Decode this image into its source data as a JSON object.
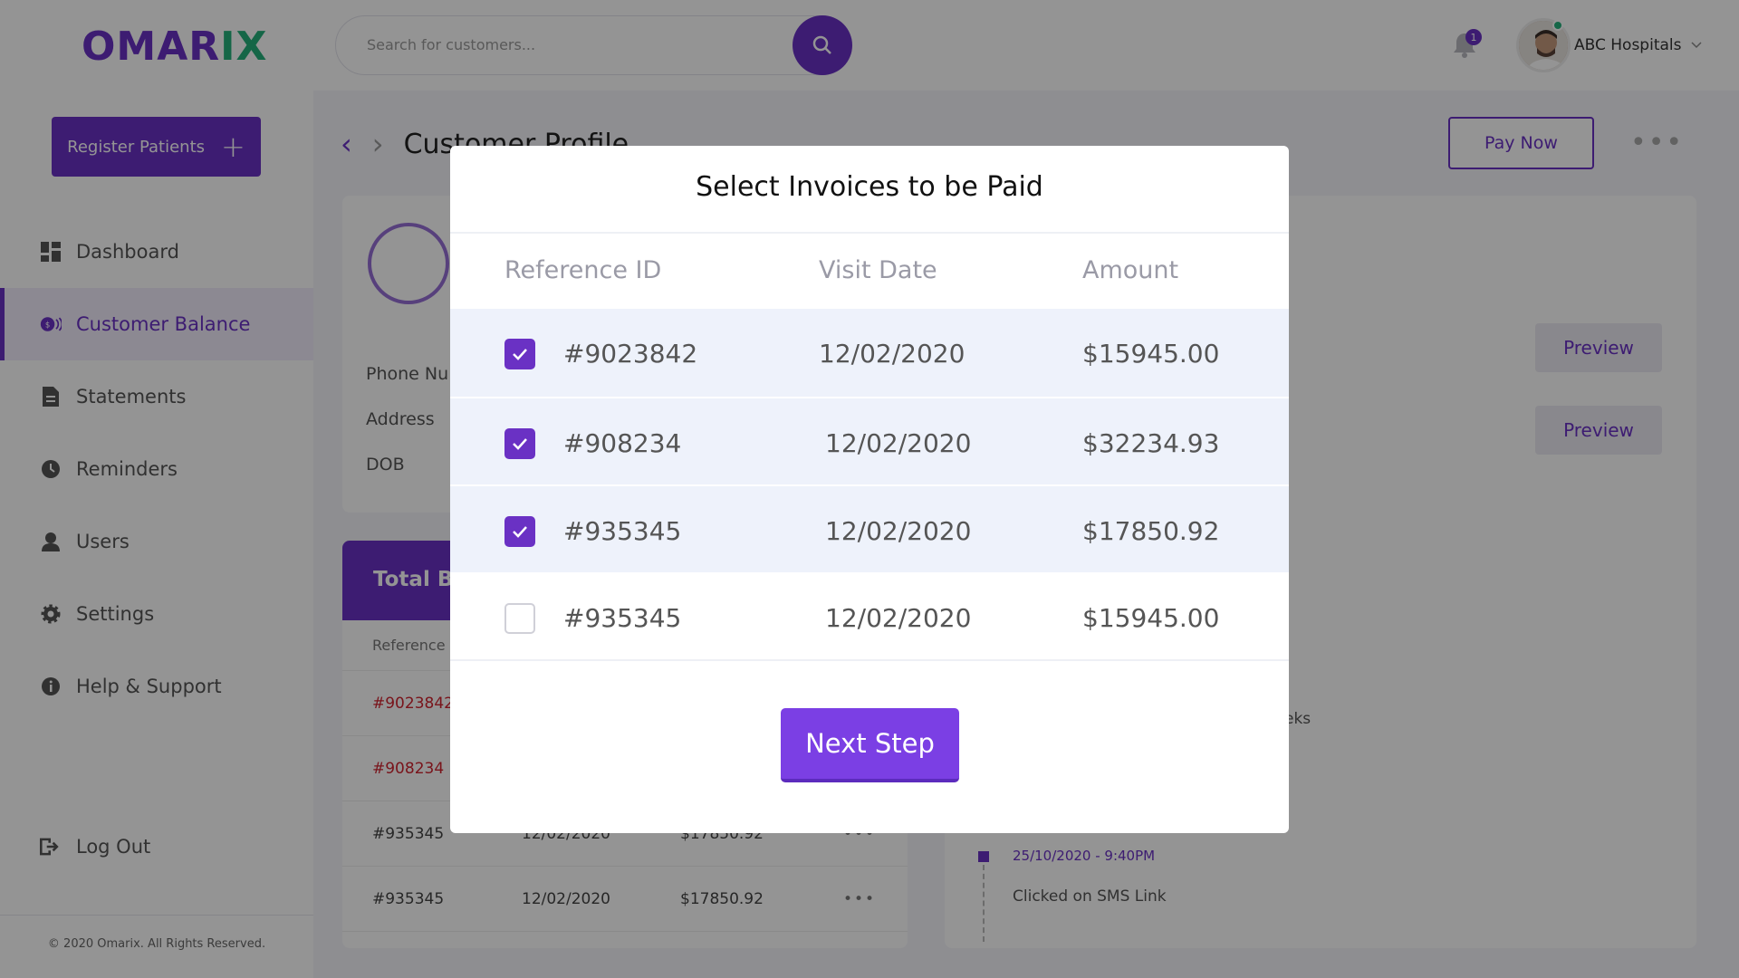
{
  "app": {
    "logo_part1": "OMAR",
    "logo_part2": "IX",
    "copyright": "© 2020 Omarix. All Rights Reserved."
  },
  "sidebar": {
    "register_label": "Register Patients",
    "items": [
      {
        "label": "Dashboard",
        "icon": "dashboard-icon"
      },
      {
        "label": "Customer Balance",
        "icon": "balance-icon",
        "active": true
      },
      {
        "label": "Statements",
        "icon": "document-icon"
      },
      {
        "label": "Reminders",
        "icon": "clock-icon"
      },
      {
        "label": "Users",
        "icon": "user-icon"
      },
      {
        "label": "Settings",
        "icon": "gear-icon"
      },
      {
        "label": "Help & Support",
        "icon": "info-icon"
      }
    ],
    "logout_label": "Log Out"
  },
  "header": {
    "search_placeholder": "Search for customers...",
    "notification_count": "1",
    "account_name": "ABC Hospitals"
  },
  "page": {
    "title": "Customer Profile",
    "pay_now_label": "Pay Now",
    "profile_fields": [
      "Phone Nu",
      "Address",
      "DOB"
    ],
    "balance_title": "Total Ba",
    "balance_column_header": "Reference",
    "balance_rows": [
      {
        "ref": "#9023842",
        "date": "",
        "amount": "",
        "red": true
      },
      {
        "ref": "#908234",
        "date": "",
        "amount": "",
        "red": true
      },
      {
        "ref": "#935345",
        "date": "12/02/2020",
        "amount": "$17850.92",
        "red": false
      },
      {
        "ref": "#935345",
        "date": "12/02/2020",
        "amount": "$17850.92",
        "red": false
      }
    ],
    "preview_label": "Preview",
    "weeks_text": "eks",
    "timeline_date": "25/10/2020 - 9:40PM",
    "timeline_text": "Clicked on SMS Link"
  },
  "modal": {
    "title": "Select Invoices to be Paid",
    "columns": {
      "ref": "Reference ID",
      "date": "Visit Date",
      "amount": "Amount"
    },
    "invoices": [
      {
        "ref": "#9023842",
        "date": "12/02/2020",
        "amount": "$15945.00",
        "checked": true
      },
      {
        "ref": "#908234",
        "date": "12/02/2020",
        "amount": "$32234.93",
        "checked": true
      },
      {
        "ref": "#935345",
        "date": "12/02/2020",
        "amount": "$17850.92",
        "checked": true
      },
      {
        "ref": "#935345",
        "date": "12/02/2020",
        "amount": "$15945.00",
        "checked": false
      }
    ],
    "next_label": "Next Step"
  },
  "colors": {
    "accent": "#6a31c4",
    "brand_green": "#25b07a",
    "danger": "#d1242f"
  }
}
